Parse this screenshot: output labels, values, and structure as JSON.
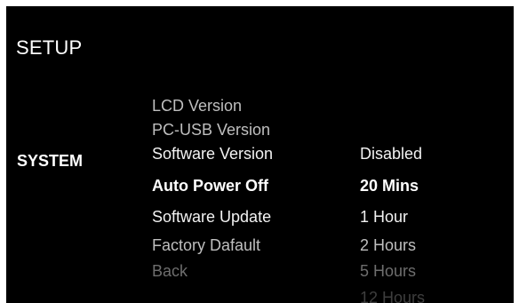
{
  "header": {
    "title": "SETUP"
  },
  "category": {
    "label": "SYSTEM"
  },
  "menu": {
    "items": [
      {
        "label": "LCD Version"
      },
      {
        "label": "PC-USB Version"
      },
      {
        "label": "Software Version"
      },
      {
        "label": "Auto Power Off"
      },
      {
        "label": "Software Update"
      },
      {
        "label": "Factory Dafault"
      },
      {
        "label": "Back"
      }
    ],
    "selected_label": "Auto Power Off"
  },
  "options": {
    "items": [
      {
        "label": "Disabled"
      },
      {
        "label": "20 Mins"
      },
      {
        "label": "1 Hour"
      },
      {
        "label": "2 Hours"
      },
      {
        "label": "5 Hours"
      },
      {
        "label": "12 Hours"
      }
    ],
    "selected_label": "20 Mins"
  },
  "colors": {
    "background": "#000000",
    "text": "#ffffff",
    "dimmed_text": "#bfbfbf",
    "faded_text": "#6e6e6e"
  }
}
